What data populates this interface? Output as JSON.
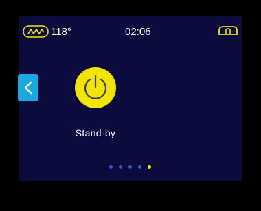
{
  "status_bar": {
    "temperature": "118°",
    "time": "02:06"
  },
  "icons": {
    "heater": "heater-icon",
    "seat": "seat-icon",
    "back": "chevron-left-icon",
    "power": "power-icon"
  },
  "main": {
    "mode_label": "Stand-by"
  },
  "pager": {
    "page_count": 5,
    "active_index": 4
  },
  "colors": {
    "screen_background": "#0b0c3d",
    "accent_yellow": "#f2e600",
    "back_button": "#1aa8e0",
    "inactive_dot": "#2f55d8"
  }
}
